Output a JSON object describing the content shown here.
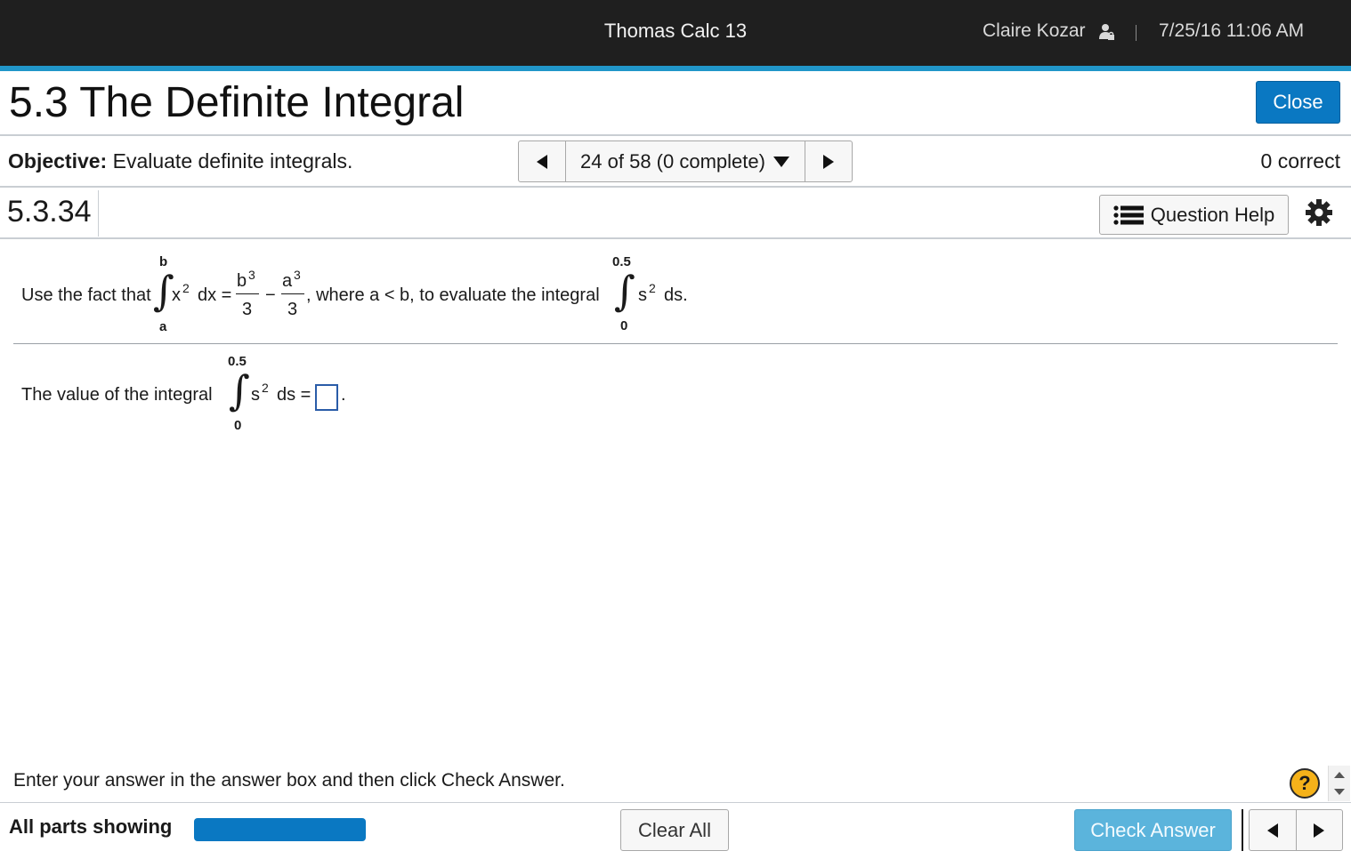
{
  "header": {
    "app_title": "Thomas Calc 13",
    "user_name": "Claire Kozar",
    "datetime": "7/25/16 11:06 AM",
    "accent_color": "#2196c9"
  },
  "title_row": {
    "page_title": "5.3 The Definite Integral",
    "close_label": "Close"
  },
  "objective_row": {
    "objective_label": "Objective:",
    "objective_text": "Evaluate definite integrals.",
    "question_selector": "24 of 58 (0 complete)",
    "correct_text": "0 correct"
  },
  "question_row": {
    "question_id": "5.3.34",
    "help_label": "Question Help"
  },
  "problem": {
    "intro": "Use the fact that",
    "int1_upper": "b",
    "int1_lower": "a",
    "int1_integrand": "x",
    "int1_power": "2",
    "int1_dx": "dx =",
    "frac1_num": "b",
    "frac1_num_power": "3",
    "frac1_den": "3",
    "minus": "−",
    "frac2_num": "a",
    "frac2_num_power": "3",
    "frac2_den": "3",
    "middle": ", where a < b, to evaluate the integral",
    "int2_upper": "0.5",
    "int2_lower": "0",
    "int2_integrand": "s",
    "int2_power": "2",
    "int2_ds": "ds."
  },
  "answer_part": {
    "prefix": "The value of the integral",
    "int_upper": "0.5",
    "int_lower": "0",
    "integrand": "s",
    "power": "2",
    "ds": "ds =",
    "suffix": "."
  },
  "footer": {
    "instruction": "Enter your answer in the answer box and then click Check Answer.",
    "all_parts": "All parts showing",
    "progress_fraction": 1.0,
    "clear_label": "Clear All",
    "check_label": "Check Answer",
    "help_symbol": "?"
  }
}
